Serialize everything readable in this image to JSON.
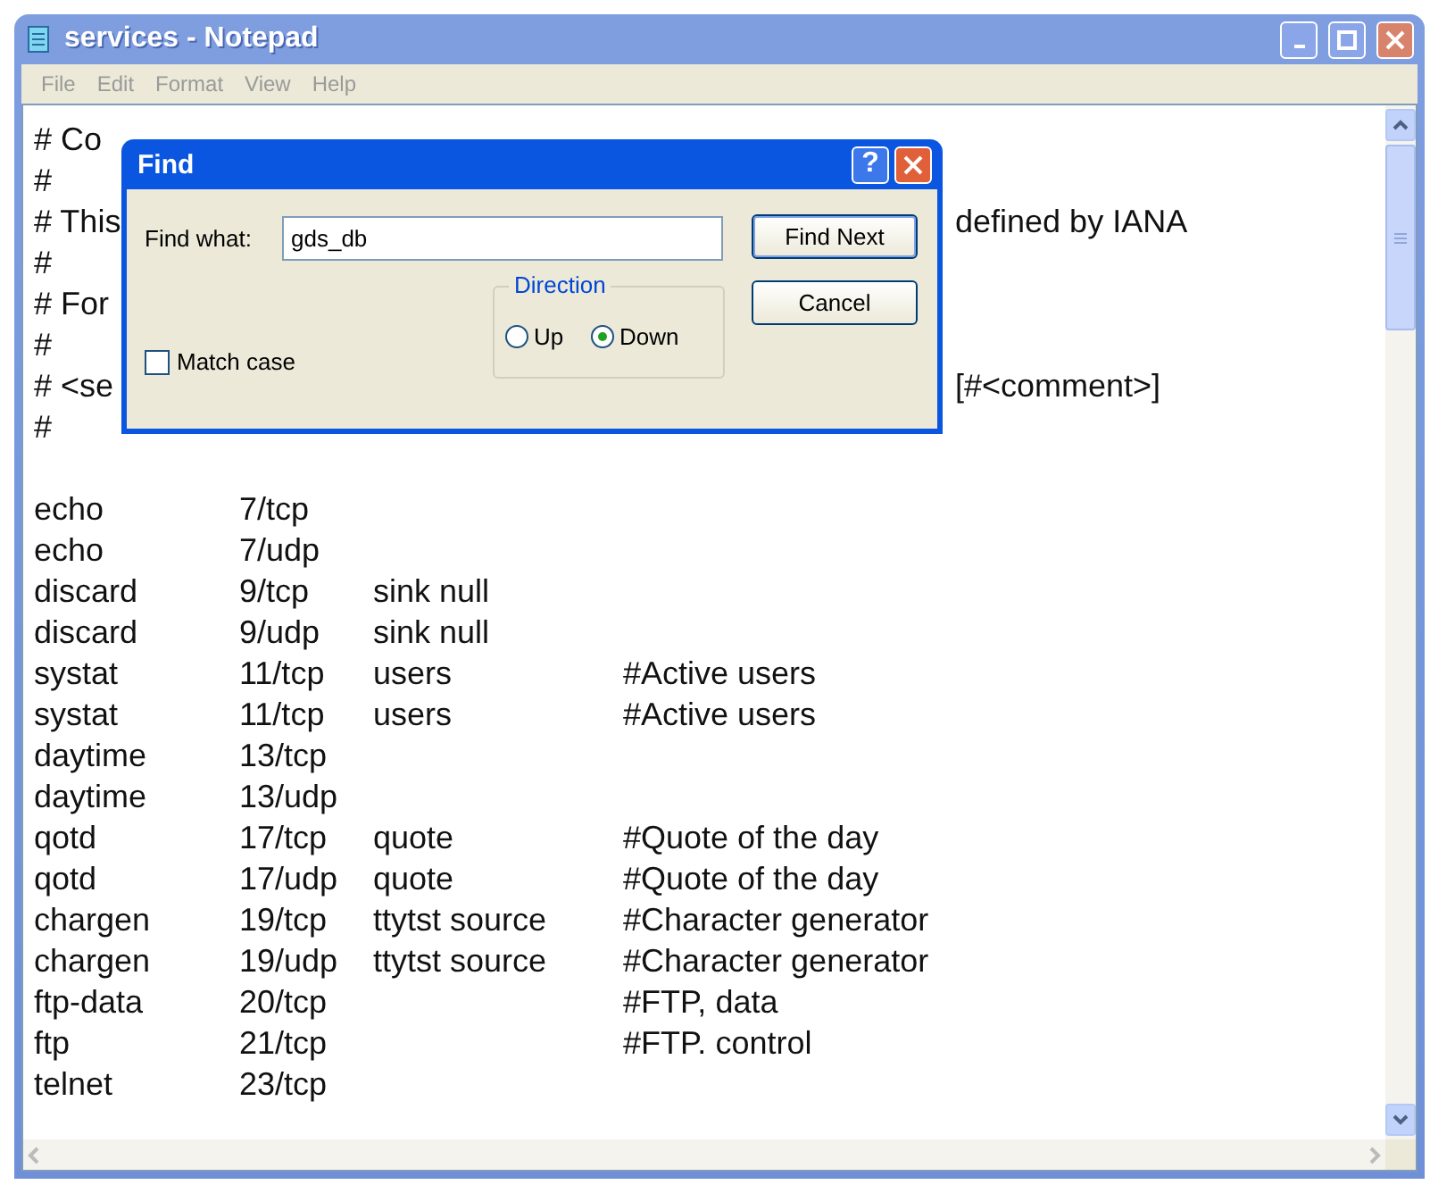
{
  "window": {
    "title": "services - Notepad"
  },
  "menu": [
    "File",
    "Edit",
    "Format",
    "View",
    "Help"
  ],
  "header_lines": [
    {
      "left": "# Co"
    },
    {
      "left": "#"
    },
    {
      "left": "# This",
      "right": "defined by IANA"
    },
    {
      "left": "#"
    },
    {
      "left": "# For"
    },
    {
      "left": "#"
    },
    {
      "left": "# <se",
      "right": "[#<comment>]"
    },
    {
      "left": "#"
    }
  ],
  "entries": [
    {
      "name": "echo",
      "port": "7/tcp"
    },
    {
      "name": "echo",
      "port": "7/udp"
    },
    {
      "name": "discard",
      "port": "9/tcp",
      "alias": "sink null"
    },
    {
      "name": "discard",
      "port": "9/udp",
      "alias": "sink null"
    },
    {
      "name": "systat",
      "port": "11/tcp",
      "alias": "users",
      "comment": "#Active users"
    },
    {
      "name": "systat",
      "port": "11/tcp",
      "alias": "users",
      "comment": "#Active users"
    },
    {
      "name": "daytime",
      "port": "13/tcp"
    },
    {
      "name": "daytime",
      "port": "13/udp"
    },
    {
      "name": "qotd",
      "port": "17/tcp",
      "alias": "quote",
      "comment": "#Quote of the day"
    },
    {
      "name": "qotd",
      "port": "17/udp",
      "alias": "quote",
      "comment": "#Quote of the day"
    },
    {
      "name": "chargen",
      "port": "19/tcp",
      "alias": "ttytst source",
      "comment": "#Character generator"
    },
    {
      "name": "chargen",
      "port": "19/udp",
      "alias": "ttytst source",
      "comment": "#Character generator"
    },
    {
      "name": "ftp-data",
      "port": "20/tcp",
      "comment": "#FTP, data"
    },
    {
      "name": "ftp",
      "port": "21/tcp",
      "comment": "#FTP. control"
    },
    {
      "name": "telnet",
      "port": "23/tcp"
    }
  ],
  "find_dialog": {
    "title": "Find",
    "help": "?",
    "find_label": "Find what:",
    "find_value": "gds_db",
    "find_next": "Find Next",
    "cancel": "Cancel",
    "direction_label": "Direction",
    "directions": [
      {
        "label": "Up",
        "selected": false
      },
      {
        "label": "Down",
        "selected": true
      }
    ],
    "match_case": {
      "label": "Match case",
      "checked": false
    }
  }
}
